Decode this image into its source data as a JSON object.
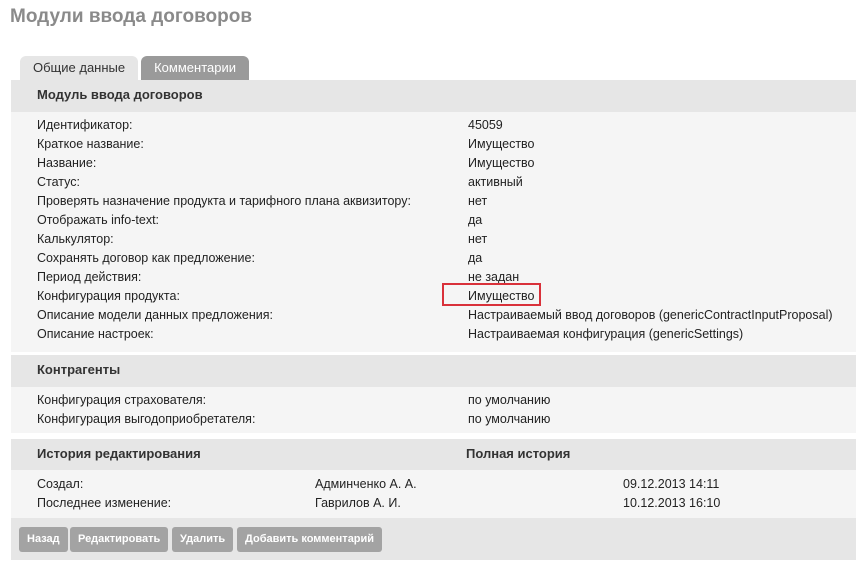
{
  "page": {
    "title": "Модули ввода договоров"
  },
  "tabs": [
    {
      "label": "Общие данные",
      "active": true
    },
    {
      "label": "Комментарии",
      "active": false
    }
  ],
  "module": {
    "header": "Модуль ввода договоров",
    "rows": [
      {
        "label": "Идентификатор:",
        "value": "45059"
      },
      {
        "label": "Краткое название:",
        "value": "Имущество"
      },
      {
        "label": "Название:",
        "value": "Имущество"
      },
      {
        "label": "Статус:",
        "value": "активный"
      },
      {
        "label": "Проверять назначение продукта и тарифного плана аквизитору:",
        "value": "нет"
      },
      {
        "label": "Отображать info-text:",
        "value": "да"
      },
      {
        "label": "Калькулятор:",
        "value": "нет"
      },
      {
        "label": "Сохранять договор как предложение:",
        "value": "да"
      },
      {
        "label": "Период действия:",
        "value": "не задан"
      },
      {
        "label": "Конфигурация продукта:",
        "value": "Имущество"
      },
      {
        "label": "Описание модели данных предложения:",
        "value": "Настраиваемый ввод договоров (genericContractInputProposal)"
      },
      {
        "label": "Описание настроек:",
        "value": "Настраиваемая конфигурация (genericSettings)"
      }
    ]
  },
  "counterparties": {
    "header": "Контрагенты",
    "rows": [
      {
        "label": "Конфигурация страхователя:",
        "value": "по умолчанию"
      },
      {
        "label": "Конфигурация выгодоприобретателя:",
        "value": "по умолчанию"
      }
    ]
  },
  "history": {
    "header": "История редактирования",
    "full_history": "Полная история",
    "rows": [
      {
        "label": "Создал:",
        "user": "Админченко А. А.",
        "date": "09.12.2013 14:11"
      },
      {
        "label": "Последнее изменение:",
        "user": "Гаврилов А. И.",
        "date": "10.12.2013 16:10"
      }
    ]
  },
  "toolbar": {
    "back": "Назад",
    "edit": "Редактировать",
    "delete": "Удалить",
    "add_comment": "Добавить комментарий"
  },
  "colors": {
    "highlight": "#d9313a",
    "tab_inactive": "#9a9a9a",
    "button": "#a3a3a3"
  }
}
